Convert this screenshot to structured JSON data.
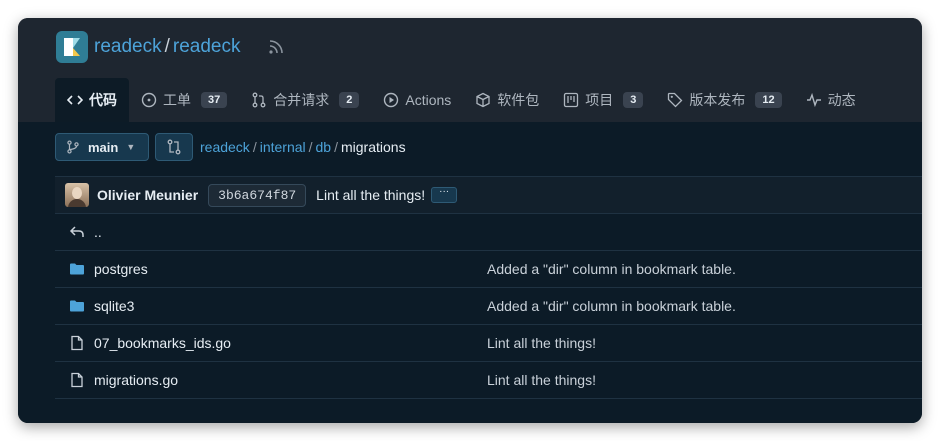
{
  "repo": {
    "owner": "readeck",
    "separator": "/",
    "name": "readeck"
  },
  "tabs": [
    {
      "label": "代码",
      "icon": "code-icon",
      "active": true
    },
    {
      "label": "工单",
      "icon": "issue-icon",
      "count": "37"
    },
    {
      "label": "合并请求",
      "icon": "pull-request-icon",
      "count": "2"
    },
    {
      "label": "Actions",
      "icon": "play-icon"
    },
    {
      "label": "软件包",
      "icon": "package-icon"
    },
    {
      "label": "项目",
      "icon": "project-icon",
      "count": "3"
    },
    {
      "label": "版本发布",
      "icon": "tag-icon",
      "count": "12"
    },
    {
      "label": "动态",
      "icon": "pulse-icon"
    }
  ],
  "branch": {
    "label": "main"
  },
  "breadcrumb": {
    "root": "readeck",
    "p1": "internal",
    "p2": "db",
    "current": "migrations"
  },
  "commit": {
    "author": "Olivier Meunier",
    "sha": "3b6a674f87",
    "message": "Lint all the things!",
    "more": "···"
  },
  "files": {
    "parent": "..",
    "items": [
      {
        "name": "postgres",
        "type": "folder",
        "message": "Added a \"dir\" column in bookmark table."
      },
      {
        "name": "sqlite3",
        "type": "folder",
        "message": "Added a \"dir\" column in bookmark table."
      },
      {
        "name": "07_bookmarks_ids.go",
        "type": "file",
        "message": "Lint all the things!"
      },
      {
        "name": "migrations.go",
        "type": "file",
        "message": "Lint all the things!"
      }
    ]
  },
  "colors": {
    "link": "#4da3d9",
    "background": "#0c1b27",
    "folder": "#4da3d9"
  }
}
